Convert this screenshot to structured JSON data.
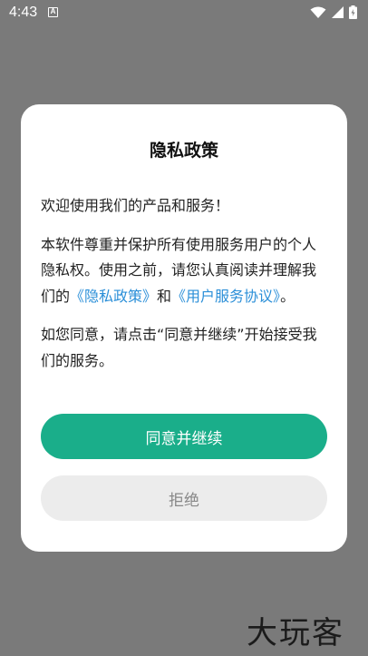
{
  "status_bar": {
    "time": "4:43",
    "notification_icon": "a-icon",
    "icons": [
      "wifi-icon",
      "signal-icon",
      "battery-icon"
    ]
  },
  "dialog": {
    "title": "隐私政策",
    "greeting": "欢迎使用我们的产品和服务！",
    "para2_text1": "本软件尊重并保护所有使用服务用户的个人隐私权。使用之前，请您认真阅读并理解我们的",
    "privacy_link": "《隐私政策》",
    "para2_and": "和",
    "user_link": "《用户服务协议》",
    "para2_end": "。",
    "para3": "如您同意，请点击“同意并继续”开始接受我们的服务。",
    "agree_label": "同意并继续",
    "reject_label": "拒绝"
  },
  "watermark": "大玩客",
  "colors": {
    "accent": "#1aae8a",
    "link": "#2b8fd8",
    "overlay": "#7a7a7a"
  }
}
